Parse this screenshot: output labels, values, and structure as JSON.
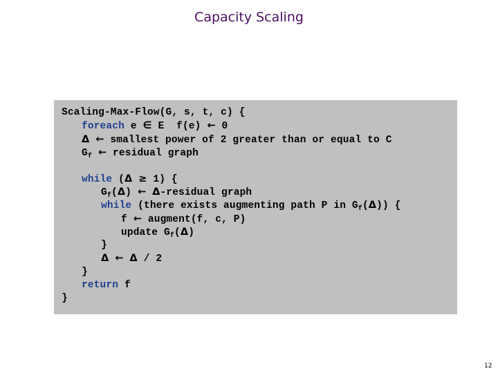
{
  "slide": {
    "title": "Capacity Scaling",
    "page_number": "12",
    "colors": {
      "title": "#4a1060",
      "keyword": "#1f3f8f",
      "code_background": "#c0c0c0"
    }
  },
  "code": {
    "l1": "Scaling-Max-Flow(G, s, t, c) {",
    "l2_kw": "foreach",
    "l2_a": " e ",
    "l2_sym": "∈",
    "l2_b": " E  f(e) ",
    "l2_arrow": "←",
    "l2_c": " 0",
    "l3_delta": "Δ",
    "l3_arrow": "←",
    "l3_text": " smallest power of 2 greater than or equal to C",
    "l4_g": "G",
    "l4_sub": "f",
    "l4_arrow": "←",
    "l4_text": " residual graph",
    "l5_kw": "while",
    "l5_a": " (",
    "l5_delta": "Δ",
    "l5_ge": "≥",
    "l5_b": " 1) {",
    "l6_g": "G",
    "l6_sub": "f",
    "l6_a": "(",
    "l6_delta": "Δ",
    "l6_b": ") ",
    "l6_arrow": "←",
    "l6_delta2": "Δ",
    "l6_text": "-residual graph",
    "l7_kw": "while",
    "l7_a": " (there exists augmenting path P in G",
    "l7_sub": "f",
    "l7_b": "(",
    "l7_delta": "Δ",
    "l7_c": ")) {",
    "l8_a": "f ",
    "l8_arrow": "←",
    "l8_b": " augment(f, c, P)",
    "l9_a": "update G",
    "l9_sub": "f",
    "l9_b": "(",
    "l9_delta": "Δ",
    "l9_c": ")",
    "l10": "}",
    "l11_delta": "Δ",
    "l11_arrow": "←",
    "l11_delta2": "Δ",
    "l11_text": " / 2",
    "l12": "}",
    "l13_kw": "return",
    "l13_text": " f",
    "l14": "}"
  }
}
